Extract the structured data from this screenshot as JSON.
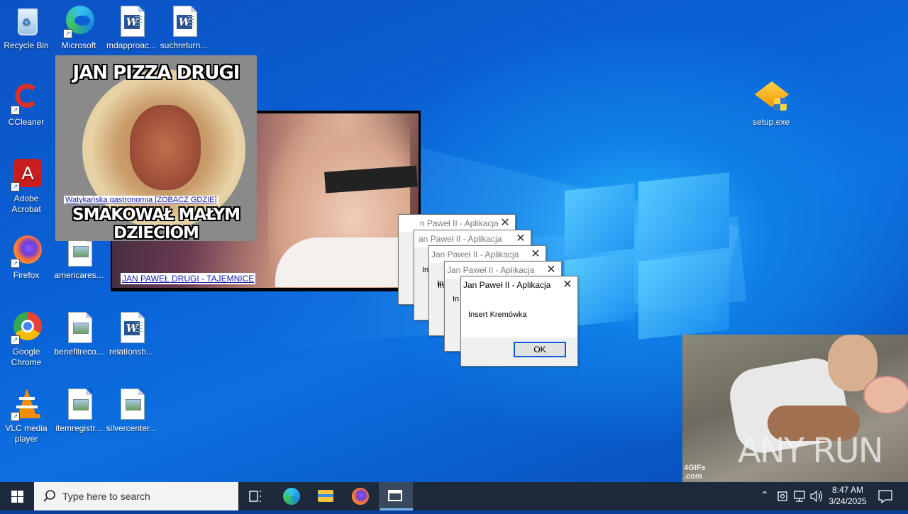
{
  "desktop": {
    "icons": [
      {
        "label": "Recycle Bin"
      },
      {
        "label": "Microsoft Edge"
      },
      {
        "label": "mdapproac..."
      },
      {
        "label": "suchreturn..."
      },
      {
        "label": "CCleaner"
      },
      {
        "label": "Adobe Acrobat"
      },
      {
        "label": "Firefox"
      },
      {
        "label": "americares..."
      },
      {
        "label": "Google Chrome"
      },
      {
        "label": "benefitreco..."
      },
      {
        "label": "relationsh..."
      },
      {
        "label": "VLC media player"
      },
      {
        "label": "itemregistr..."
      },
      {
        "label": "silvercenter..."
      },
      {
        "label": "setup.exe"
      }
    ]
  },
  "popups": {
    "pizza": {
      "title": "JAN PIZZA DRUGI",
      "link": "Watykańska gastronomia [ZOBACZ GDZIE]",
      "bottom": "SMAKOWAŁ MAŁYM DZIECIOM"
    },
    "video": {
      "caption": "JAN PAWEŁ DRUGI - TAJEMNICE"
    },
    "gif": {
      "watermark_small": "4GIFs",
      "watermark_small2": ".com",
      "watermark_brand": "ANY RUN"
    }
  },
  "dialogs": {
    "stack": [
      {
        "title": "n Paweł II - Aplikacja"
      },
      {
        "title": "an Paweł II - Aplikacja"
      },
      {
        "title": "Jan Paweł II - Aplikacja",
        "stub": "In"
      },
      {
        "title": "Jan Paweł II - Aplikacja",
        "stub": "In"
      }
    ],
    "active": {
      "title": "Jan Paweł II - Aplikacja",
      "message": "Insert Kremówka",
      "ok_label": "OK"
    },
    "partial_stubs": [
      "In",
      "In"
    ]
  },
  "taskbar": {
    "search_placeholder": "Type here to search",
    "time": "8:47 AM",
    "date": "3/24/2025"
  },
  "colors": {
    "accent": "#0a5fd6",
    "taskbar": "#1c2a3c"
  }
}
